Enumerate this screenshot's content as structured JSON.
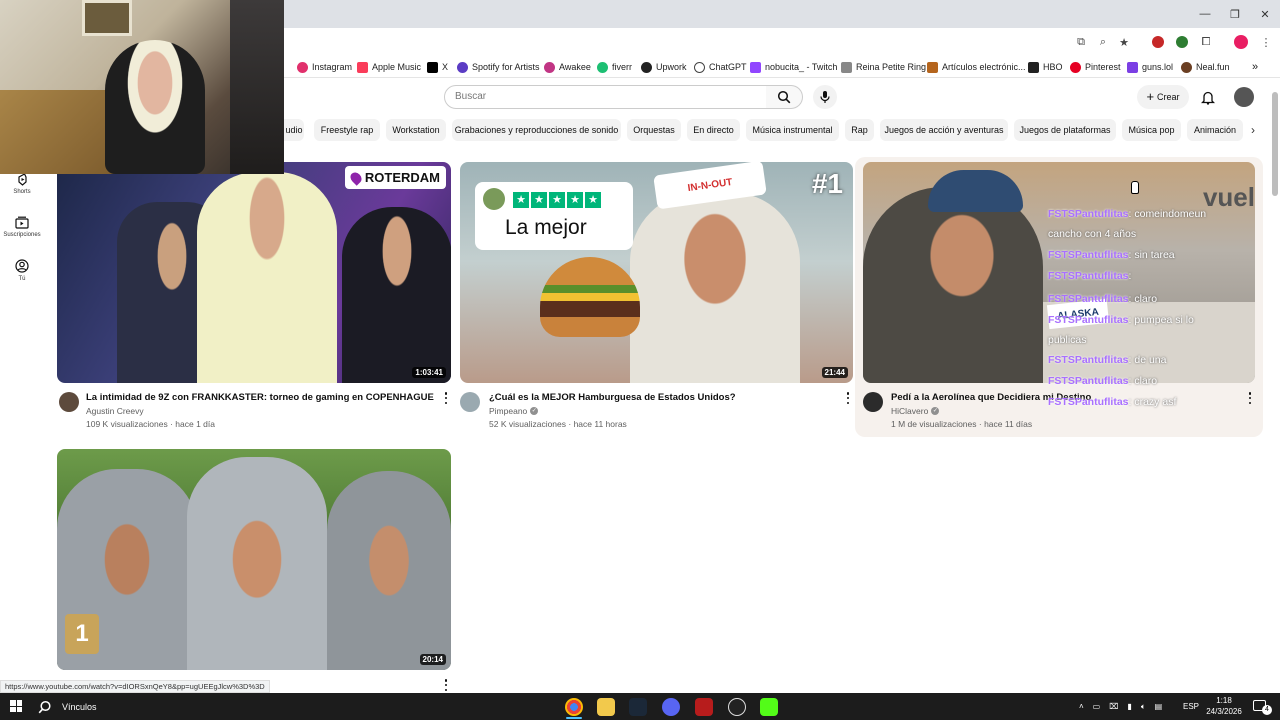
{
  "browser": {
    "bookmarks": [
      {
        "label": "Instagram",
        "color": "#e1306c"
      },
      {
        "label": "Apple Music",
        "color": "#fa3c5a"
      },
      {
        "label": "X",
        "color": "#000000"
      },
      {
        "label": "Spotify for Artists",
        "color": "#5b3cc4"
      },
      {
        "label": "Awakee",
        "color": "#c13584"
      },
      {
        "label": "fiverr",
        "color": "#1dbf73"
      },
      {
        "label": "Upwork",
        "color": "#222222"
      },
      {
        "label": "ChatGPT",
        "color": "#444444"
      },
      {
        "label": "nobucita_ - Twitch",
        "color": "#9146ff"
      },
      {
        "label": "Reina Petite Ring",
        "color": "#888888"
      },
      {
        "label": "Artículos electrónic...",
        "color": "#b5651d"
      },
      {
        "label": "HBO",
        "color": "#222222"
      },
      {
        "label": "Pinterest",
        "color": "#e60023"
      },
      {
        "label": "guns.lol",
        "color": "#7b3fe4"
      },
      {
        "label": "Neal.fun",
        "color": "#6b3f23"
      }
    ],
    "bookmarks_more": "»",
    "status_url": "https://www.youtube.com/watch?v=dIORSxnQeY8&pp=ugUEEgJlcw%3D%3D"
  },
  "youtube": {
    "search_placeholder": "Buscar",
    "create_label": "Crear",
    "chips": [
      "udio",
      "Freestyle rap",
      "Workstation",
      "Grabaciones y reproducciones de sonido",
      "Orquestas",
      "En directo",
      "Música instrumental",
      "Rap",
      "Juegos de acción y aventuras",
      "Juegos de plataformas",
      "Música pop",
      "Animación"
    ],
    "sidebar": [
      {
        "label": "Shorts",
        "icon": "shorts-icon"
      },
      {
        "label": "Suscripciones",
        "icon": "subscriptions-icon"
      },
      {
        "label": "Tú",
        "icon": "user-icon"
      }
    ],
    "videos": [
      {
        "title": "La intimidad de 9Z con FRANKKASTER: torneo de gaming en COPENHAGUE",
        "channel": "Agustin Creevy",
        "verified": false,
        "meta": "109 K visualizaciones · hace 1 día",
        "duration": "1:03:41",
        "thumb_text": "ROTERDAM"
      },
      {
        "title": "¿Cuál es la MEJOR Hamburguesa de Estados Unidos?",
        "channel": "Pimpeano",
        "verified": true,
        "meta": "52 K visualizaciones · hace 11 horas",
        "duration": "21:44",
        "thumb_text": "La mejor",
        "thumb_badge": "#1",
        "thumb_cap": "IN-N-OUT"
      },
      {
        "title": "Pedí a la Aerolínea que Decidiera mi Destino",
        "channel": "HiClavero",
        "verified": true,
        "meta": "1 M de visualizaciones · hace 11 días",
        "duration": "",
        "thumb_text": "vuel",
        "thumb_sign": "ALASKA"
      },
      {
        "title": "",
        "channel": "",
        "verified": false,
        "meta": "",
        "duration": "20:14",
        "thumb_text": "1"
      }
    ],
    "chat_overlay": [
      {
        "user": "FSTSPantuflitas",
        "msg": ": comeindomeun"
      },
      {
        "user": "",
        "msg": "cancho con 4 años"
      },
      {
        "user": "FSTSPantuflitas",
        "msg": ": sin tarea"
      },
      {
        "user": "FSTSPantuflitas",
        "msg": ":"
      },
      {
        "user": "FSTSPantuflitas",
        "msg": ": claro"
      },
      {
        "user": "FSTSPantuflitas",
        "msg": ": pumpea si lo"
      },
      {
        "user": "",
        "msg": "publicas"
      },
      {
        "user": "FSTSPantuflitas",
        "msg": ": de una"
      },
      {
        "user": "FSTSPantuflitas",
        "msg": ": claro"
      },
      {
        "user": "FSTSPantuflitas",
        "msg": ": crazy asf"
      }
    ]
  },
  "taskbar": {
    "search_label": "Vínculos",
    "lang": "ESP",
    "time": "1:18",
    "date": "24/3/2026",
    "notification_count": "4"
  }
}
